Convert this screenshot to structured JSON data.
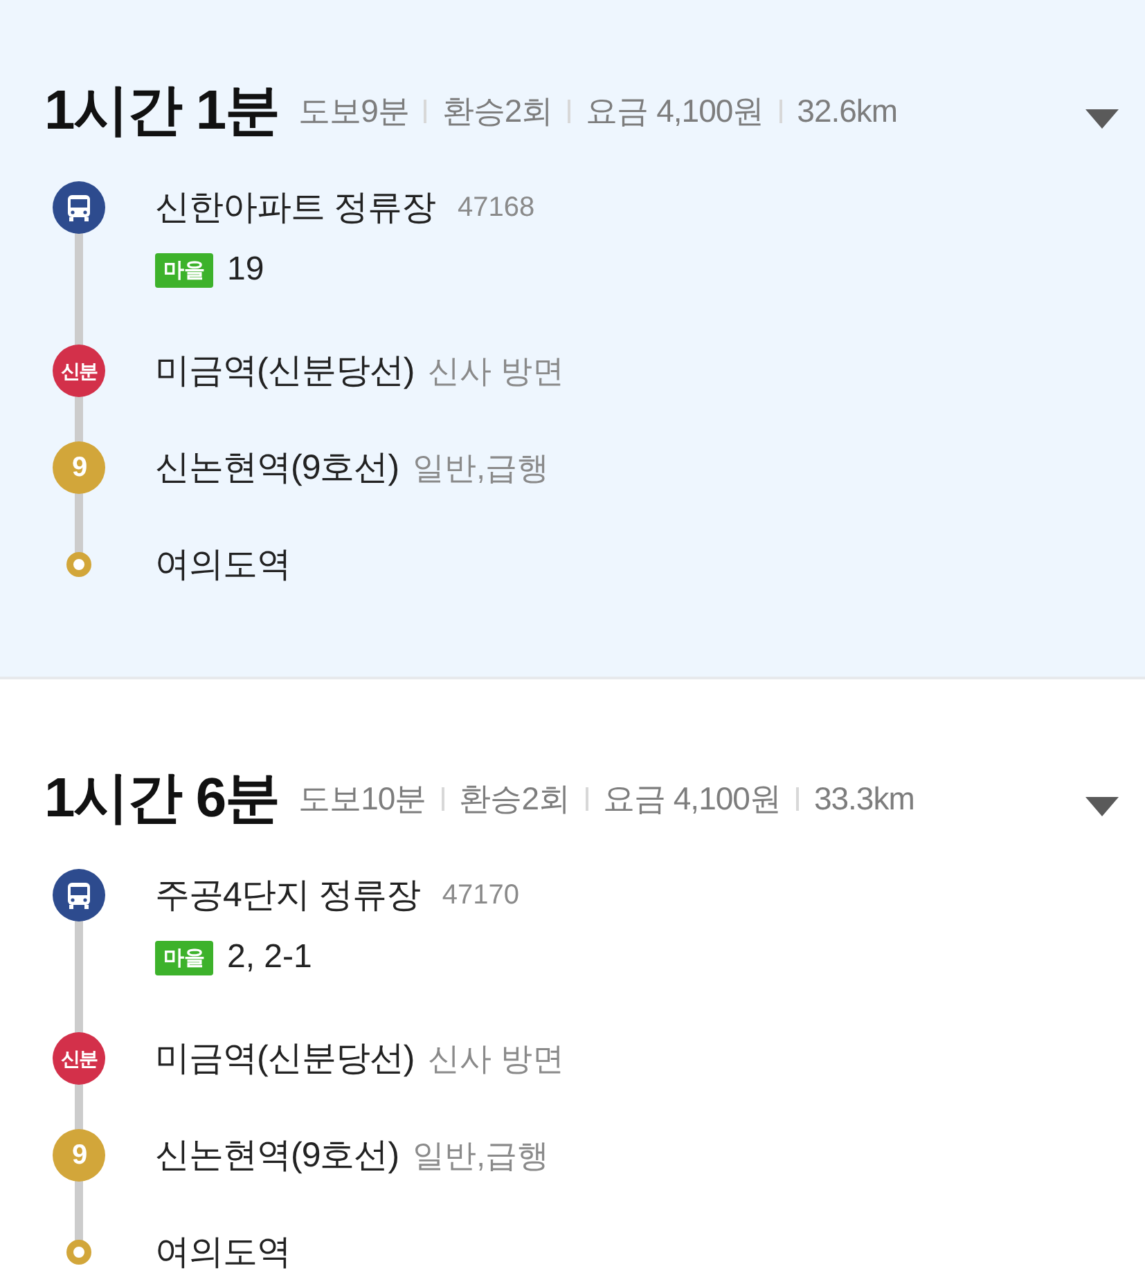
{
  "routes": [
    {
      "selected": true,
      "duration": "1시간 1분",
      "summary": [
        "도보9분",
        "환승2회",
        "요금 4,100원",
        "32.6km"
      ],
      "steps": [
        {
          "kind": "bus",
          "color": "#2d4b8e",
          "name": "신한아파트 정류장",
          "stop_number": "47168",
          "bus_type": "마을",
          "bus_numbers": "19"
        },
        {
          "kind": "subway",
          "color": "#d3304a",
          "line_label": "신분",
          "name": "미금역(신분당선)",
          "detail": "신사 방면"
        },
        {
          "kind": "subway",
          "color": "#d2a63a",
          "line_label": "9",
          "name": "신논현역(9호선)",
          "detail": "일반,급행"
        },
        {
          "kind": "end",
          "color": "#d2a63a",
          "name": "여의도역"
        }
      ]
    },
    {
      "selected": false,
      "duration": "1시간 6분",
      "summary": [
        "도보10분",
        "환승2회",
        "요금 4,100원",
        "33.3km"
      ],
      "steps": [
        {
          "kind": "bus",
          "color": "#2d4b8e",
          "name": "주공4단지 정류장",
          "stop_number": "47170",
          "bus_type": "마을",
          "bus_numbers": "2, 2-1"
        },
        {
          "kind": "subway",
          "color": "#d3304a",
          "line_label": "신분",
          "name": "미금역(신분당선)",
          "detail": "신사 방면"
        },
        {
          "kind": "subway",
          "color": "#d2a63a",
          "line_label": "9",
          "name": "신논현역(9호선)",
          "detail": "일반,급행"
        },
        {
          "kind": "end",
          "color": "#d2a63a",
          "name": "여의도역"
        }
      ]
    }
  ]
}
